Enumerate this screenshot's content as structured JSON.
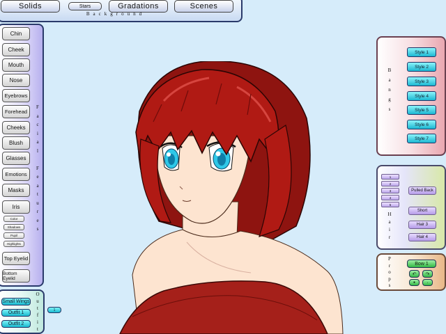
{
  "background_bar": {
    "solids": "Solids",
    "stars": "Stars",
    "gradations": "Gradations",
    "scenes": "Scenes",
    "caption": "Background"
  },
  "facial_features": {
    "label": "Facial Features",
    "buttons": [
      "Chin",
      "Cheek",
      "Mouth",
      "Nose",
      "Eyebrows",
      "Forehead",
      "Cheeks",
      "Blush",
      "Glasses",
      "Emotions",
      "Masks",
      "Iris"
    ],
    "iris_sub": [
      "Color",
      "Shadows",
      "Pupil",
      "Highlights"
    ],
    "top_eyelid": "Top Eyelid",
    "bottom_eyelid": "Bottom Eyelid"
  },
  "outfit": {
    "label": "Outfit",
    "buttons": [
      "Small Wings",
      "Outfit 1",
      "Outfit 2"
    ],
    "extra": "1"
  },
  "bangs": {
    "label": "Bangs",
    "styles": [
      "Style 1",
      "Style 2",
      "Style 3",
      "Style 4",
      "Style 5",
      "Style 6",
      "Style 7"
    ]
  },
  "hair": {
    "label": "Hair",
    "numbers": [
      "1",
      "2",
      "3",
      "4",
      "5"
    ],
    "buttons": [
      "Pulled Back",
      "Short",
      "Hair 3",
      "Hair 4"
    ]
  },
  "props": {
    "label": "Props",
    "bow": "Bow 1",
    "arrows": [
      "↶",
      "↷"
    ],
    "dots": [
      "●",
      "·"
    ]
  },
  "colors": {
    "background": "#d6ecfa",
    "hair": "#b01a14",
    "hair_shadow": "#6e0c0a",
    "skin": "#fde4d0",
    "eyes": "#2ec8e8",
    "dress": "#a5201a",
    "cyan_button": "#1cb8d2",
    "green_button": "#33b845"
  }
}
